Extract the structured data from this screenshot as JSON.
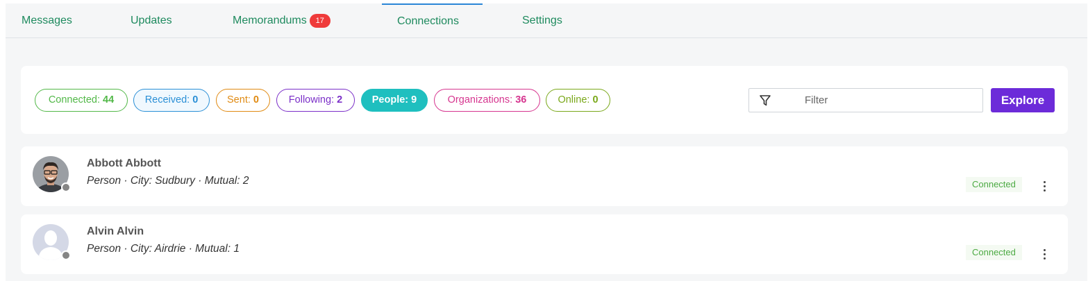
{
  "tabs": [
    {
      "label": "Messages",
      "badge": ""
    },
    {
      "label": "Updates",
      "badge": ""
    },
    {
      "label": "Memorandums",
      "badge": "17"
    },
    {
      "label": "Connections",
      "badge": "",
      "active": true
    },
    {
      "label": "Settings",
      "badge": ""
    }
  ],
  "chips": [
    {
      "label": "Connected:",
      "count": "44",
      "color": "#52b848"
    },
    {
      "label": "Received:",
      "count": "0",
      "color": "#2a8fd6"
    },
    {
      "label": "Sent:",
      "count": "0",
      "color": "#e08a12"
    },
    {
      "label": "Following:",
      "count": "2",
      "color": "#7b2fc8"
    },
    {
      "label": "People:",
      "count": "9",
      "color": "#1fbfbf",
      "selected": true
    },
    {
      "label": "Organizations:",
      "count": "36",
      "color": "#d6358f"
    },
    {
      "label": "Online:",
      "count": "0",
      "color": "#7aa81a"
    }
  ],
  "filter": {
    "placeholder": "Filter",
    "value": ""
  },
  "explore_label": "Explore",
  "connections": [
    {
      "name": "Abbott Abbott",
      "meta": "Person · City: Sudbury · Mutual: 2",
      "status": "Connected",
      "avatar": "photo"
    },
    {
      "name": "Alvin Alvin",
      "meta": "Person · City: Airdrie · Mutual: 1",
      "status": "Connected",
      "avatar": "placeholder"
    }
  ],
  "colors": {
    "accent": "#6c2bd9",
    "tab_text": "#1e8a5e",
    "badge": "#ef3b3b",
    "connected": "#4caa43"
  }
}
